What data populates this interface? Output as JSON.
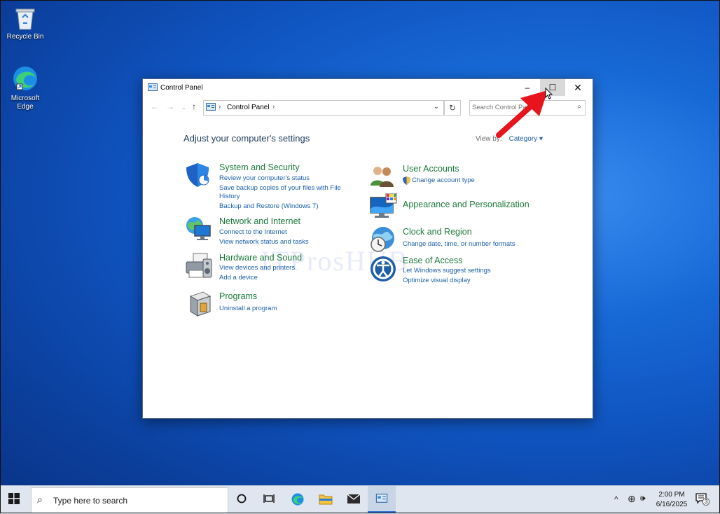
{
  "desktop": {
    "icons": [
      {
        "label": "Recycle Bin",
        "icon": "recycle-bin-icon"
      },
      {
        "label": "Microsoft Edge",
        "icon": "edge-icon"
      }
    ]
  },
  "window": {
    "title": "Control Panel",
    "controls": {
      "minimize": "–",
      "maximize": "☐",
      "close": "✕"
    },
    "address": {
      "crumb": "Control Panel",
      "separator": "›"
    },
    "search_placeholder": "Search Control Panel",
    "heading": "Adjust your computer's settings",
    "view_by_label": "View by:",
    "view_by_value": "Category ▾",
    "categories_left": [
      {
        "title": "System and Security",
        "icon": "shield-icon",
        "links": [
          "Review your computer's status",
          "Save backup copies of your files with File",
          "History",
          "Backup and Restore (Windows 7)"
        ]
      },
      {
        "title": "Network and Internet",
        "icon": "network-globe-icon",
        "links": [
          "Connect to the Internet",
          "View network status and tasks"
        ]
      },
      {
        "title": "Hardware and Sound",
        "icon": "printer-speaker-icon",
        "links": [
          "View devices and printers",
          "Add a device"
        ]
      },
      {
        "title": "Programs",
        "icon": "programs-box-icon",
        "links": [
          "Uninstall a program"
        ]
      }
    ],
    "categories_right": [
      {
        "title": "User Accounts",
        "icon": "users-icon",
        "links": [
          "Change account type"
        ]
      },
      {
        "title": "Appearance and Personalization",
        "icon": "monitor-palette-icon",
        "links": []
      },
      {
        "title": "Clock and Region",
        "icon": "clock-globe-icon",
        "links": [
          "Change date, time, or number formats"
        ]
      },
      {
        "title": "Ease of Access",
        "icon": "ease-of-access-icon",
        "links": [
          "Let Windows suggest settings",
          "Optimize visual display"
        ]
      }
    ]
  },
  "watermark": "ITProsHUB",
  "taskbar": {
    "search_placeholder": "Type here to search",
    "time": "2:00 PM",
    "date": "6/16/2025",
    "notification_count": "3"
  },
  "colors": {
    "category_title": "#1b7a3a",
    "link": "#1c5fa8",
    "annotation_arrow": "#e8141b"
  }
}
